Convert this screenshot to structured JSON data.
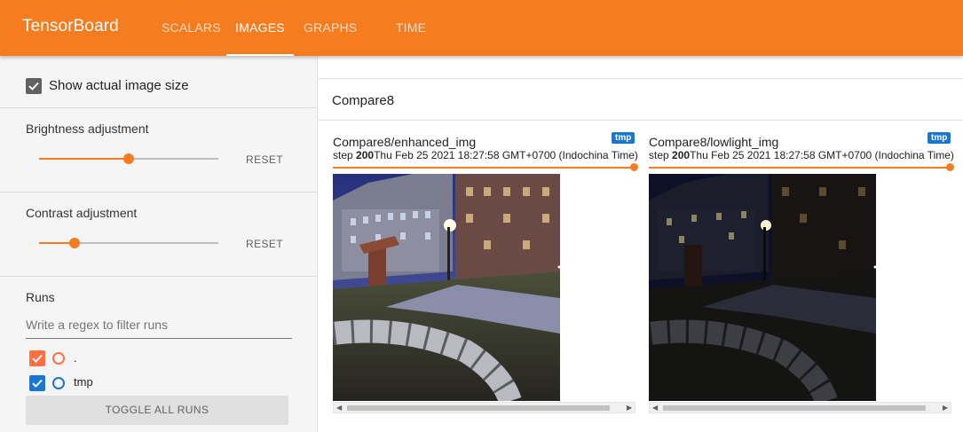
{
  "app": {
    "title": "TensorBoard",
    "accent_color": "#f57c1f"
  },
  "nav": {
    "tabs": [
      {
        "label": "SCALARS",
        "active": false
      },
      {
        "label": "IMAGES",
        "active": true
      },
      {
        "label": "GRAPHS",
        "active": false
      },
      {
        "label": "TIME SERIES",
        "active": false
      }
    ]
  },
  "sidebar": {
    "show_actual_size": {
      "label": "Show actual image size",
      "checked": true
    },
    "brightness": {
      "title": "Brightness adjustment",
      "value": 0.5,
      "reset_label": "RESET"
    },
    "contrast": {
      "title": "Contrast adjustment",
      "value": 0.2,
      "reset_label": "RESET"
    },
    "runs": {
      "title": "Runs",
      "filter_placeholder": "Write a regex to filter runs",
      "items": [
        {
          "name": ".",
          "checked": true,
          "color": "#ff7043",
          "checkbox_icon": "check-icon"
        },
        {
          "name": "tmp",
          "checked": true,
          "color": "#1976d2",
          "checkbox_icon": "check-icon"
        }
      ],
      "toggle_all_label": "TOGGLE ALL RUNS"
    }
  },
  "main": {
    "group_title": "Compare8",
    "cards": [
      {
        "title": "Compare8/enhanced_img",
        "run_badge": "tmp",
        "step_prefix": "step",
        "step_value": "200",
        "timestamp": "Thu Feb 25 2021 18:27:58 GMT+0700 (Indochina Time)",
        "step_position": 1.0,
        "image_desc": "enhanced-night-courtyard-photo"
      },
      {
        "title": "Compare8/lowlight_img",
        "run_badge": "tmp",
        "step_prefix": "step",
        "step_value": "200",
        "timestamp": "Thu Feb 25 2021 18:27:58 GMT+0700 (Indochina Time)",
        "step_position": 1.0,
        "image_desc": "lowlight-night-courtyard-photo"
      }
    ]
  }
}
